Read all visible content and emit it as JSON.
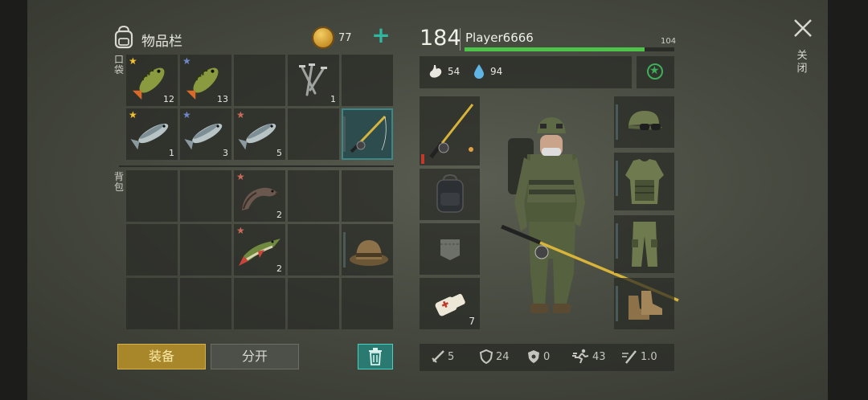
{
  "inventory": {
    "title": "物品栏",
    "coins": "77",
    "pockets_label": "口袋",
    "backpack_label": "背包",
    "pocket_items": [
      {
        "name": "perch",
        "qty": "12",
        "star": "gold"
      },
      {
        "name": "perch",
        "qty": "13",
        "star": "blue"
      },
      {
        "name": "empty"
      },
      {
        "name": "nails",
        "qty": "1"
      },
      {
        "name": "empty"
      },
      {
        "name": "trout",
        "qty": "1",
        "star": "gold"
      },
      {
        "name": "trout",
        "qty": "3",
        "star": "blue"
      },
      {
        "name": "trout",
        "qty": "5",
        "star": "red"
      },
      {
        "name": "empty"
      },
      {
        "name": "fishing-rod",
        "selected": true
      }
    ],
    "backpack_items": [
      {
        "slot": 3,
        "name": "catfish",
        "qty": "2",
        "star": "red"
      },
      {
        "slot": 8,
        "name": "pike",
        "qty": "2",
        "star": "red"
      },
      {
        "slot": 10,
        "name": "bucket-hat"
      }
    ],
    "buttons": {
      "equip": "装备",
      "split": "分开"
    }
  },
  "player": {
    "level": "184",
    "name": "Player6666",
    "xp_value": "104",
    "xp_progress": 0.86,
    "hunger": "54",
    "thirst": "94"
  },
  "equipment": {
    "left": [
      "fishing-rod",
      "backpack",
      "pocket",
      "bandage"
    ],
    "bandage_qty": "7",
    "right": [
      "military-cap",
      "armor-vest",
      "camo-pants",
      "boots"
    ]
  },
  "combat_stats": {
    "attack": "5",
    "defense": "24",
    "toxic_defense": "0",
    "speed": "43",
    "attack_speed": "1.0"
  },
  "close_label": "关闭",
  "colors": {
    "accent_teal": "#2fb7a0",
    "xp_green": "#4ec34a",
    "equip_gold": "#a8862a"
  }
}
